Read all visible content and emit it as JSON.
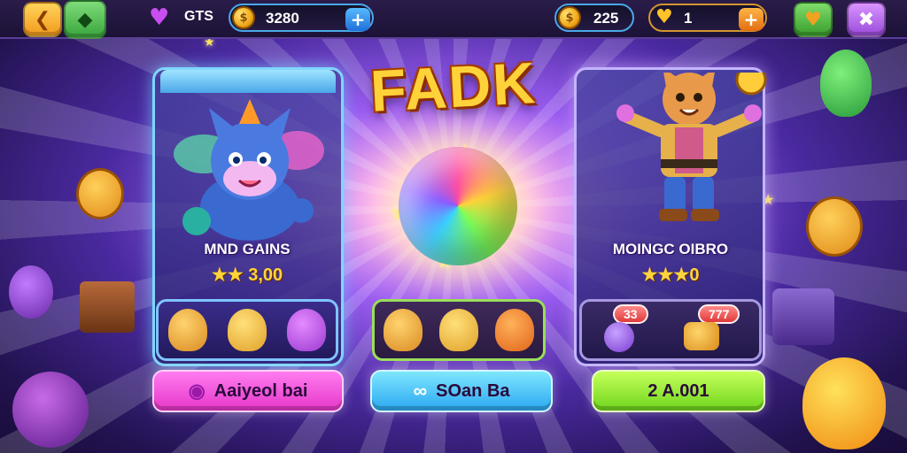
{
  "top_bar": {
    "stat_label": "GTS",
    "gold_value": "3280",
    "coin_value": "225",
    "heart_value": "1"
  },
  "title": "FADK",
  "cards": [
    {
      "name": "MND GAINS",
      "stars": "★★ 3,00"
    },
    {
      "name": "MOINGC OIBRO",
      "stars": "★★★0"
    }
  ],
  "right_tray_prices": [
    "33",
    "777"
  ],
  "buttons": {
    "pink": "Aaiyeol bai",
    "blue": "SOan Ba",
    "green": "2 A.001"
  },
  "colors": {
    "accent_pink": "#e636c8",
    "accent_blue": "#2aa8f0",
    "accent_green": "#6ed61c",
    "title_gold": "#ffd23a"
  },
  "icons": {
    "back": "back-arrow-icon",
    "gem": "gem-icon",
    "heart": "heart-icon",
    "close": "close-icon",
    "coin": "coin-icon",
    "plus": "plus-icon"
  }
}
